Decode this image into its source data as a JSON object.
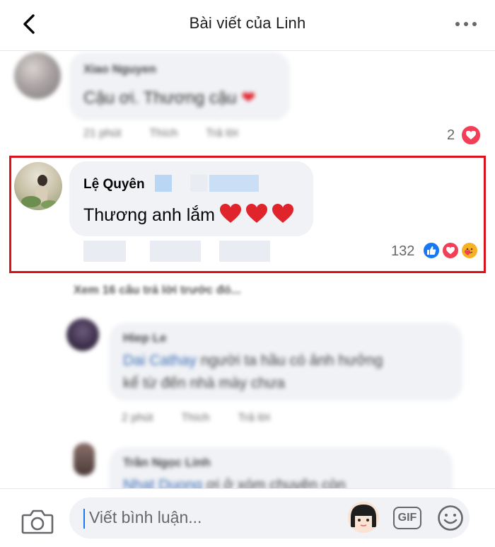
{
  "header": {
    "title": "Bài viết của Linh"
  },
  "comment_top": {
    "author": "Xiao Nguyen",
    "text": "Cậu ơi. Thương cậu",
    "meta": [
      "21 phút",
      "Thích",
      "Trả lời"
    ],
    "reaction_count": "2"
  },
  "comment_main": {
    "author": "Lệ Quyên",
    "text": "Thương anh lắm",
    "reaction_count": "132"
  },
  "view_replies": "Xem 16 câu trả lời trước đó...",
  "reply_1": {
    "author": "Hiep Le",
    "tag": "Dai Cathay",
    "text_line1": "người ta hầu có ảnh hưởng",
    "text_line2": "kể từ đến nhà mày chưa",
    "meta": [
      "2 phút",
      "Thích",
      "Trả lời"
    ]
  },
  "reply_2": {
    "author": "Trần Ngọc Linh",
    "tag": "Nhat Duong",
    "text_line1": "ơi ở xóm chuyện còn"
  },
  "composer": {
    "placeholder": "Viết bình luận...",
    "gif_label": "GIF"
  },
  "colors": {
    "highlight_border": "#d9121b",
    "like_blue": "#1877f2",
    "love_red": "#f33e58",
    "care_yellow": "#f7b125"
  },
  "icons": {
    "back": "chevron-left-icon",
    "more": "more-horizontal-icon",
    "camera": "camera-icon",
    "gif": "gif-icon",
    "emoji": "smiley-icon"
  }
}
